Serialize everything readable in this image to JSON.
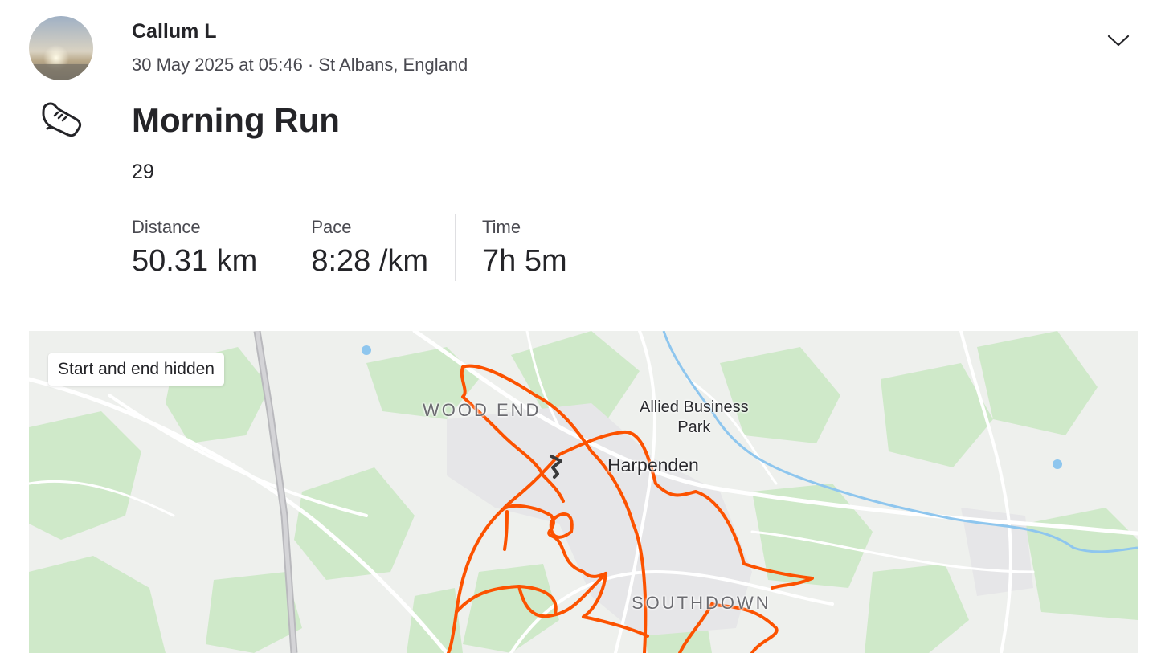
{
  "athlete": {
    "name": "Callum L"
  },
  "activity": {
    "meta": "30 May 2025 at 05:46 · St Albans, England",
    "title": "Morning Run",
    "description": "29",
    "sport_icon": "running-shoe-icon"
  },
  "stats": [
    {
      "label": "Distance",
      "value": "50.31 km"
    },
    {
      "label": "Pace",
      "value": "8:28 /km"
    },
    {
      "label": "Time",
      "value": "7h 5m"
    }
  ],
  "header": {
    "menu_icon": "chevron-down-icon"
  },
  "map": {
    "privacy_badge": "Start and end hidden",
    "labels": {
      "wood_end": "WOOD END",
      "allied_business_park": "Allied Business\nPark",
      "harpenden": "Harpenden",
      "southdown": "SOUTHDOWN"
    },
    "colors": {
      "route": "#fc5200",
      "route_hidden": "#3a3a3a",
      "green": "#cdebc8",
      "water": "#8ec6ee"
    }
  }
}
